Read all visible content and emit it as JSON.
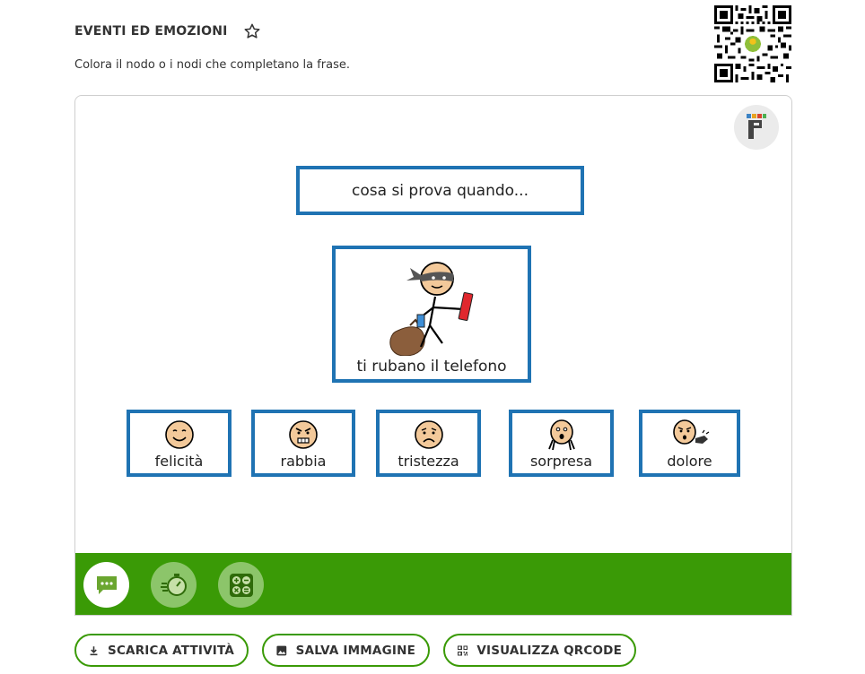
{
  "header": {
    "title": "EVENTI ED EMOZIONI",
    "favorite_icon": "star-outline-icon",
    "instructions": "Colora il nodo o i nodi che completano la frase."
  },
  "qr_code": {
    "icon": "qr-code"
  },
  "board": {
    "question": "cosa si prova quando...",
    "event": {
      "label": "ti rubano il telefono",
      "icon": "thief-stealing-phone-pictogram"
    },
    "emotions": [
      {
        "label": "felicità",
        "icon": "happy-face-pictogram"
      },
      {
        "label": "rabbia",
        "icon": "angry-face-pictogram"
      },
      {
        "label": "tristezza",
        "icon": "sad-face-pictogram"
      },
      {
        "label": "sorpresa",
        "icon": "surprised-face-pictogram"
      },
      {
        "label": "dolore",
        "icon": "pain-face-pictogram"
      }
    ],
    "border_color": "#1f73b3"
  },
  "toolbar": {
    "color": "#3a9a06",
    "tools": [
      "comments-icon",
      "timer-icon",
      "calculator-icon"
    ]
  },
  "actions": [
    {
      "label": "SCARICA ATTIVITÀ",
      "icon": "download-icon"
    },
    {
      "label": "SALVA IMMAGINE",
      "icon": "image-icon"
    },
    {
      "label": "VISUALIZZA QRCODE",
      "icon": "qr-code-icon"
    }
  ]
}
